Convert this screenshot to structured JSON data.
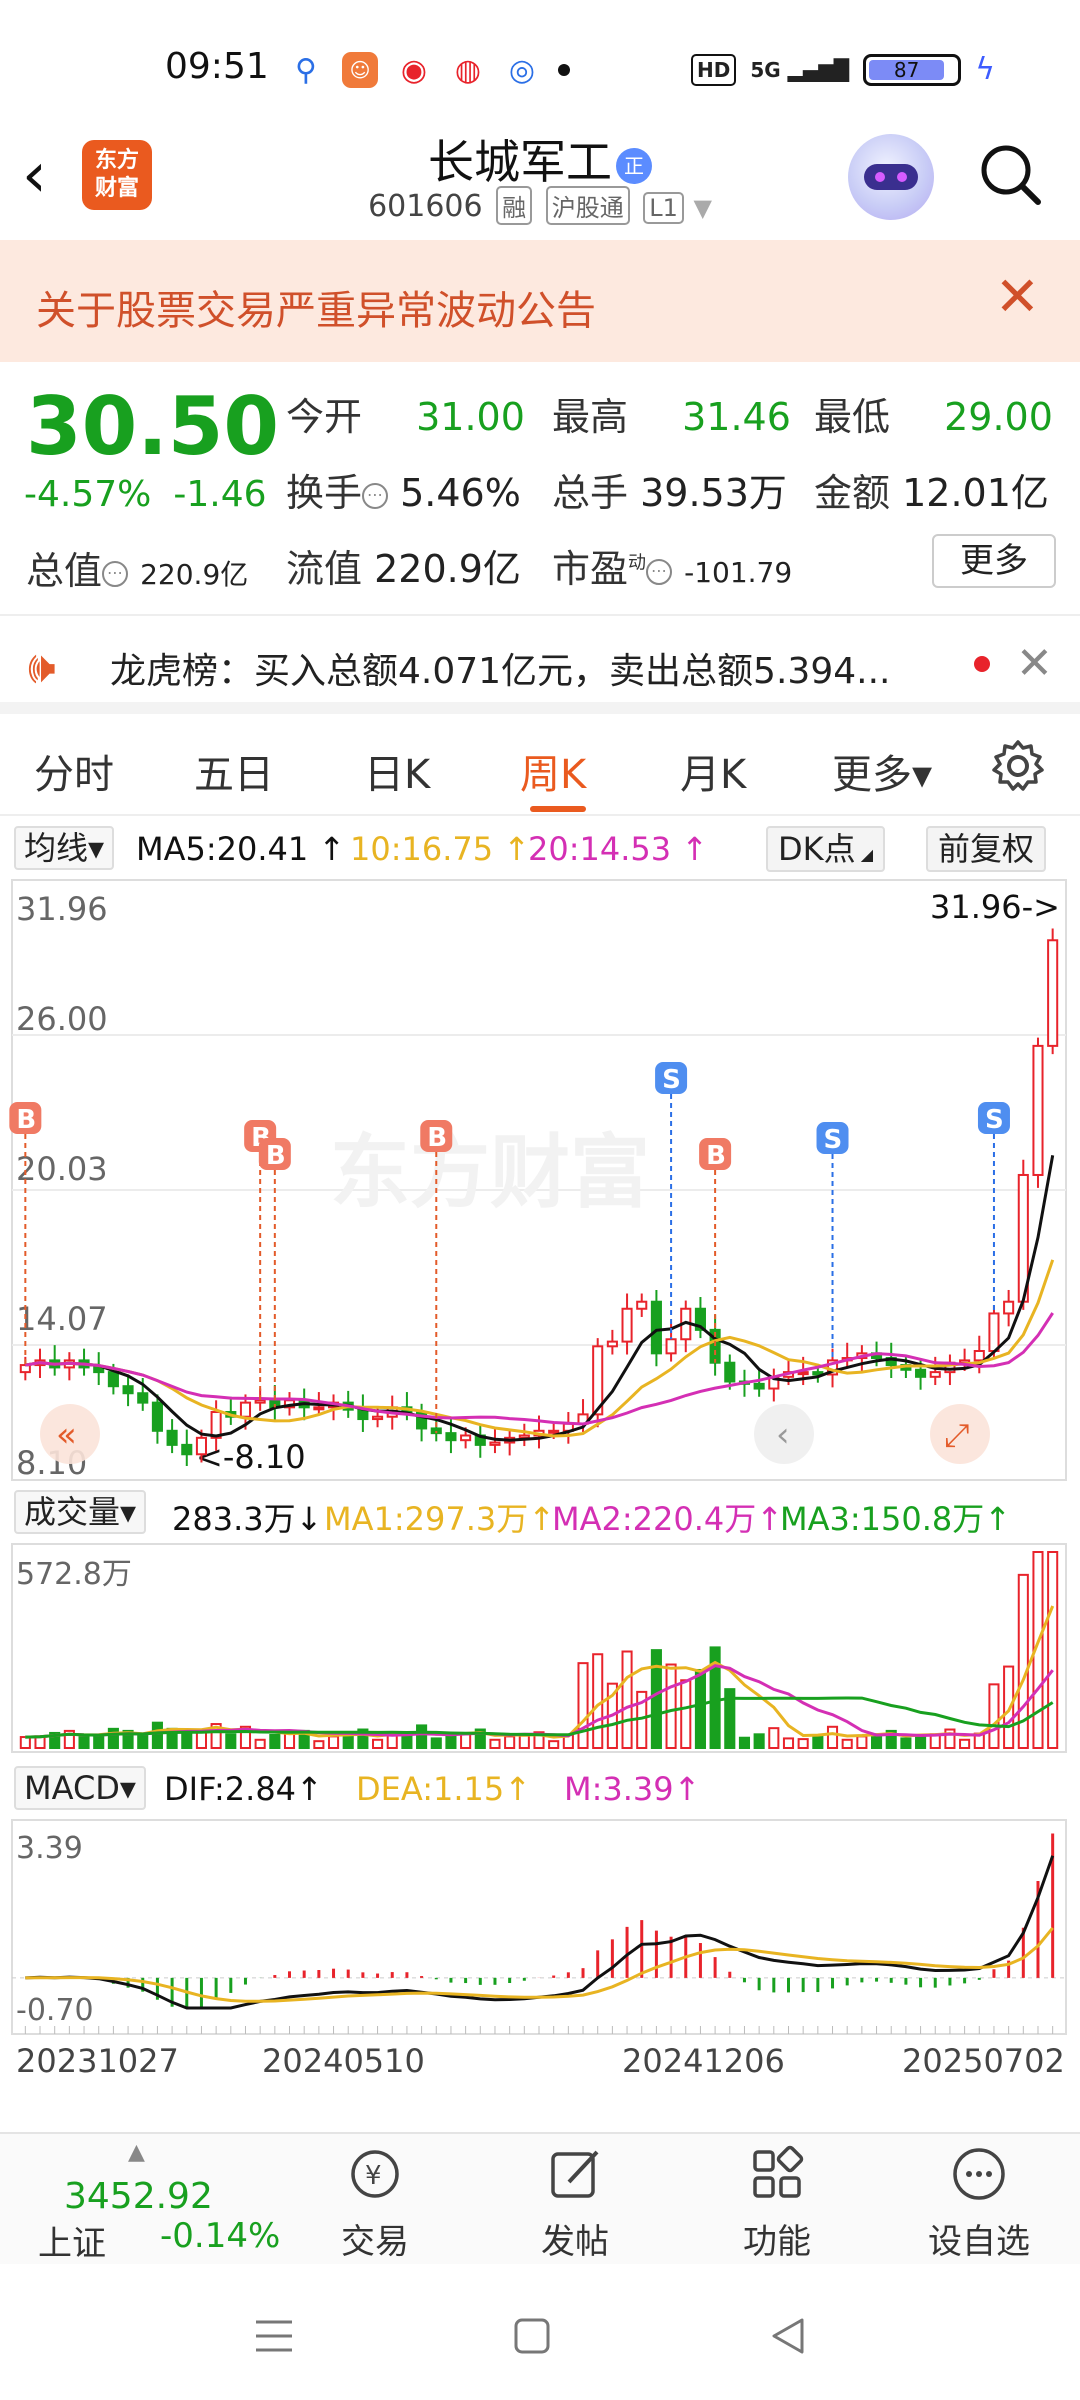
{
  "status": {
    "time": "09:51",
    "hd": "HD",
    "network": "5G",
    "battery": "87"
  },
  "header": {
    "logo_line1": "东方",
    "logo_line2": "财富",
    "title": "长城军工",
    "title_badge": "正",
    "code": "601606",
    "tags": [
      "融",
      "沪股通",
      "L1"
    ]
  },
  "banner": {
    "text": "关于股票交易严重异常波动公告"
  },
  "quote": {
    "price": "30.50",
    "change_pct": "-4.57%",
    "change": "-1.46",
    "open_label": "今开",
    "open": "31.00",
    "high_label": "最高",
    "high": "31.46",
    "low_label": "最低",
    "low": "29.00",
    "turnover_label": "换手",
    "turnover": "5.46%",
    "volume_label": "总手",
    "volume": "39.53万",
    "amount_label": "金额",
    "amount": "12.01亿",
    "mktcap_label": "总值",
    "mktcap": "220.9亿",
    "float_label": "流值",
    "float": "220.9亿",
    "pe_label": "市盈",
    "pe_sup": "动",
    "pe": "-101.79",
    "more": "更多"
  },
  "dragon": {
    "text": "龙虎榜：买入总额4.071亿元，卖出总额5.394..."
  },
  "tabs": [
    "分时",
    "五日",
    "日K",
    "周K",
    "月K",
    "更多▾"
  ],
  "active_tab": "周K",
  "kline": {
    "indicator": "均线▾",
    "ma5": "MA5:20.41 ↑",
    "ma10": "10:16.75 ↑",
    "ma20": "20:14.53 ↑",
    "dk": "DK点",
    "adjust": "前复权",
    "y_labels": [
      "31.96",
      "26.00",
      "20.03",
      "14.07",
      "8.10"
    ],
    "max_label": "31.96->",
    "min_label": "<-8.10",
    "watermark": "东方财富",
    "colors": {
      "up": "#e8232b",
      "down": "#18a01f",
      "ma5": "#111111",
      "ma10": "#e8b422",
      "ma20": "#d42fb4"
    }
  },
  "volume": {
    "indicator": "成交量▾",
    "value": "283.3万↓",
    "ma1": "MA1:297.3万↑",
    "ma2": "MA2:220.4万↑",
    "ma3": "MA3:150.8万↑",
    "y_label": "572.8万"
  },
  "macd": {
    "indicator": "MACD▾",
    "dif": "DIF:2.84↑",
    "dea": "DEA:1.15↑",
    "m": "M:3.39↑",
    "y_top": "3.39",
    "y_bottom": "-0.70"
  },
  "dates": [
    "20231027",
    "20240510",
    "20241206",
    "20250702"
  ],
  "chart_data": {
    "type": "candlestick",
    "title": "",
    "ylim": [
      8.1,
      31.96
    ],
    "y_ticks": [
      31.96,
      26.0,
      20.03,
      14.07,
      8.1
    ],
    "x_ticks": [
      "20231027",
      "20240510",
      "20241206",
      "20250702"
    ],
    "series": [
      {
        "name": "MA5",
        "last": 20.41
      },
      {
        "name": "10",
        "last": 16.75
      },
      {
        "name": "20",
        "last": 14.53
      }
    ],
    "close_series_approx": [
      12.4,
      12.6,
      12.3,
      12.6,
      12.3,
      12.1,
      11.5,
      11.2,
      10.8,
      9.6,
      9.0,
      8.6,
      9.3,
      10.4,
      10.2,
      10.8,
      10.9,
      10.6,
      10.9,
      10.6,
      10.6,
      10.8,
      10.5,
      10.1,
      10.2,
      10.6,
      10.4,
      9.7,
      9.5,
      9.2,
      9.4,
      9.0,
      9.1,
      9.3,
      9.4,
      9.6,
      9.6,
      9.9,
      10.3,
      13.2,
      13.4,
      14.8,
      15.1,
      12.9,
      13.5,
      14.8,
      13.9,
      12.5,
      11.7,
      11.6,
      11.4,
      11.9,
      12.1,
      12.1,
      12.0,
      12.6,
      12.7,
      12.9,
      12.7,
      12.4,
      12.2,
      11.9,
      12.1,
      12.5,
      12.6,
      13.0,
      14.6,
      15.1,
      20.5,
      26.0,
      30.5
    ],
    "markers": [
      {
        "type": "B",
        "at": 0
      },
      {
        "type": "B",
        "at": 16
      },
      {
        "type": "B",
        "at": 17
      },
      {
        "type": "B",
        "at": 28
      },
      {
        "type": "S",
        "at": 44
      },
      {
        "type": "B",
        "at": 47
      },
      {
        "type": "S",
        "at": 55
      },
      {
        "type": "S",
        "at": 66
      },
      {
        "type": "S",
        "at": 74
      }
    ],
    "volume_ylim": [
      0,
      572.8
    ],
    "macd_ylim": [
      -0.7,
      3.39
    ],
    "macd_last": {
      "DIF": 2.84,
      "DEA": 1.15,
      "M": 3.39
    }
  },
  "bottom": {
    "index_value": "3452.92",
    "index_name": "上证",
    "index_change": "-0.14%",
    "nav": [
      "交易",
      "发帖",
      "功能",
      "设自选"
    ]
  }
}
